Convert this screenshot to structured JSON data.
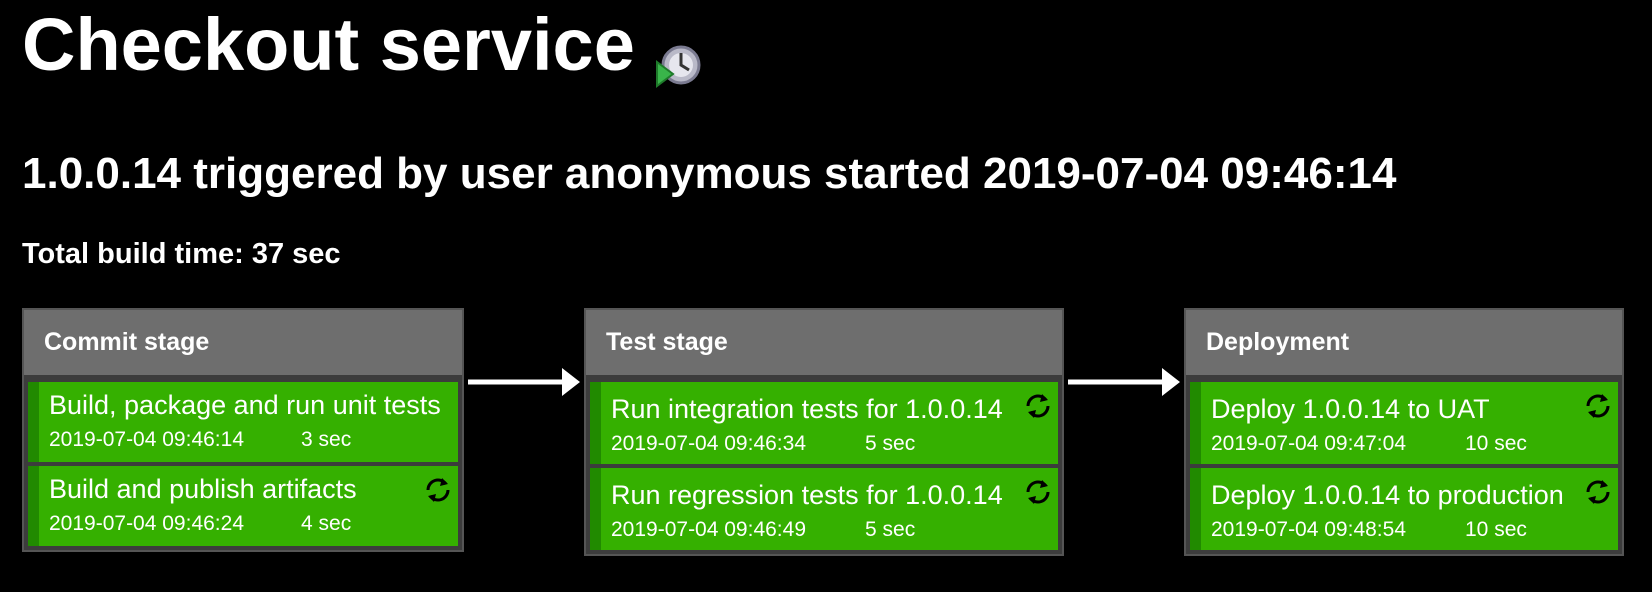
{
  "pipeline": {
    "title": "Checkout service",
    "title_icon": "build-trigger-icon",
    "build_info": "1.0.0.14 triggered by user anonymous started 2019-07-04 09:46:14",
    "total_time": "Total build time: 37 sec"
  },
  "stages": [
    {
      "name": "Commit stage",
      "jobs": [
        {
          "name": "Build, package and run unit tests",
          "started": "2019-07-04 09:46:14",
          "duration": "3 sec",
          "status_color": "#35b000",
          "retry": false
        },
        {
          "name": "Build and publish artifacts",
          "started": "2019-07-04 09:46:24",
          "duration": "4 sec",
          "status_color": "#35b000",
          "retry": true
        }
      ]
    },
    {
      "name": "Test stage",
      "jobs": [
        {
          "name": "Run integration tests for 1.0.0.14",
          "started": "2019-07-04 09:46:34",
          "duration": "5 sec",
          "status_color": "#35b000",
          "retry": true
        },
        {
          "name": "Run regression tests for 1.0.0.14",
          "started": "2019-07-04 09:46:49",
          "duration": "5 sec",
          "status_color": "#35b000",
          "retry": true
        }
      ]
    },
    {
      "name": "Deployment",
      "jobs": [
        {
          "name": "Deploy 1.0.0.14 to UAT",
          "started": "2019-07-04 09:47:04",
          "duration": "10 sec",
          "status_color": "#35b000",
          "retry": true
        },
        {
          "name": "Deploy 1.0.0.14 to production",
          "started": "2019-07-04 09:48:54",
          "duration": "10 sec",
          "status_color": "#35b000",
          "retry": true
        }
      ]
    }
  ],
  "colors": {
    "background": "#000000",
    "stage_header": "#6e6e6e",
    "job_success": "#35b000",
    "job_success_dark": "#218a00"
  }
}
